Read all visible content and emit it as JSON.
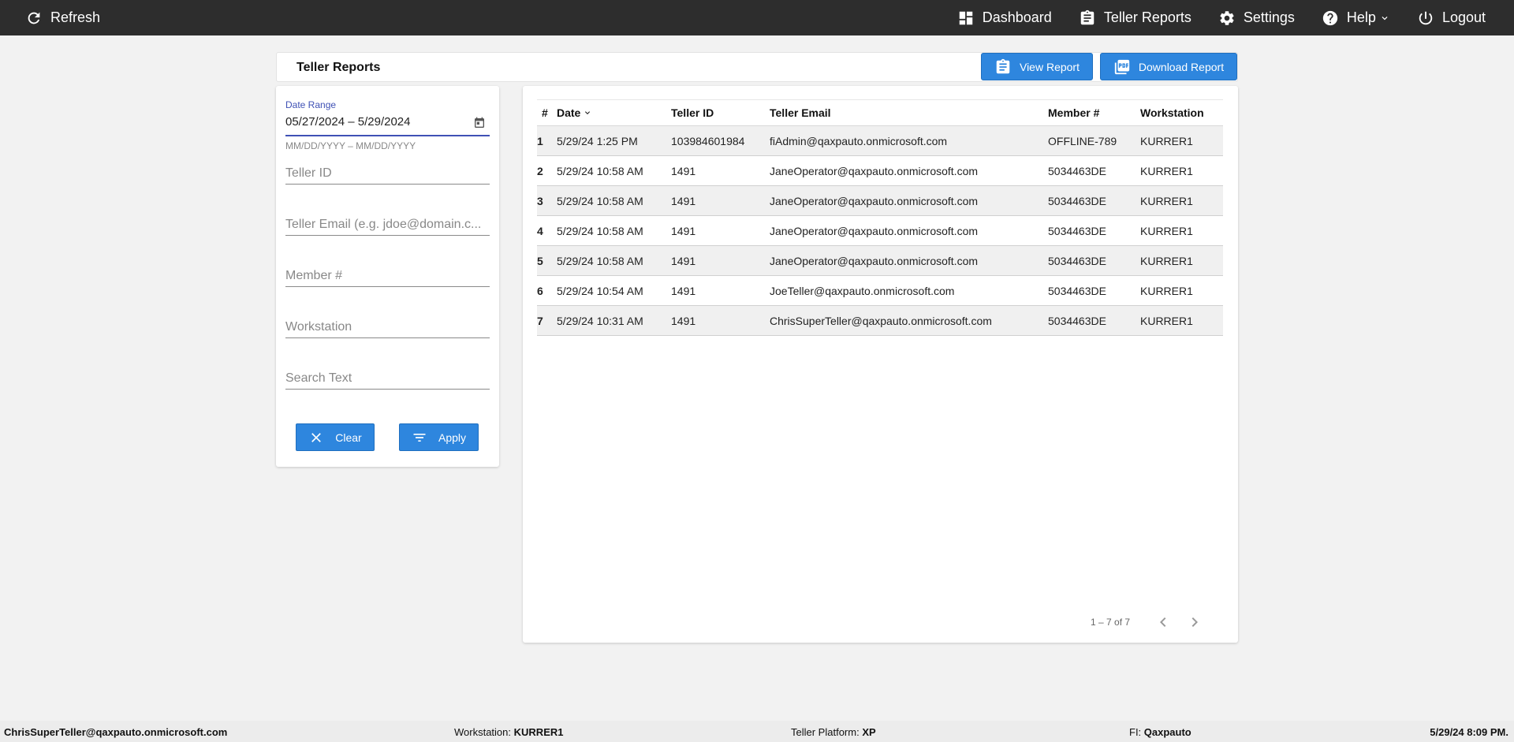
{
  "topbar": {
    "refresh_label": "Refresh",
    "nav": {
      "dashboard": "Dashboard",
      "teller_reports": "Teller Reports",
      "settings": "Settings",
      "help": "Help",
      "logout": "Logout"
    }
  },
  "header": {
    "title": "Teller Reports",
    "view_report_label": "View Report",
    "download_report_label": "Download Report"
  },
  "filters": {
    "date_range_label": "Date Range",
    "date_range_value": "05/27/2024 – 5/29/2024",
    "date_range_hint": "MM/DD/YYYY – MM/DD/YYYY",
    "teller_id_placeholder": "Teller ID",
    "teller_email_placeholder": "Teller Email (e.g. jdoe@domain.c...",
    "member_placeholder": "Member #",
    "workstation_placeholder": "Workstation",
    "search_placeholder": "Search Text",
    "clear_label": "Clear",
    "apply_label": "Apply"
  },
  "table": {
    "columns": [
      "#",
      "Date",
      "Teller ID",
      "Teller Email",
      "Member #",
      "Workstation"
    ],
    "rows": [
      [
        "1",
        "5/29/24 1:25 PM",
        "103984601984",
        "fiAdmin@qaxpauto.onmicrosoft.com",
        "OFFLINE-789",
        "KURRER1"
      ],
      [
        "2",
        "5/29/24 10:58 AM",
        "1491",
        "JaneOperator@qaxpauto.onmicrosoft.com",
        "5034463DE",
        "KURRER1"
      ],
      [
        "3",
        "5/29/24 10:58 AM",
        "1491",
        "JaneOperator@qaxpauto.onmicrosoft.com",
        "5034463DE",
        "KURRER1"
      ],
      [
        "4",
        "5/29/24 10:58 AM",
        "1491",
        "JaneOperator@qaxpauto.onmicrosoft.com",
        "5034463DE",
        "KURRER1"
      ],
      [
        "5",
        "5/29/24 10:58 AM",
        "1491",
        "JaneOperator@qaxpauto.onmicrosoft.com",
        "5034463DE",
        "KURRER1"
      ],
      [
        "6",
        "5/29/24 10:54 AM",
        "1491",
        "JoeTeller@qaxpauto.onmicrosoft.com",
        "5034463DE",
        "KURRER1"
      ],
      [
        "7",
        "5/29/24 10:31 AM",
        "1491",
        "ChrisSuperTeller@qaxpauto.onmicrosoft.com",
        "5034463DE",
        "KURRER1"
      ]
    ],
    "pagination": "1 – 7 of 7"
  },
  "footer": {
    "user": "ChrisSuperTeller@qaxpauto.onmicrosoft.com",
    "workstation_label": "Workstation:",
    "workstation_value": "KURRER1",
    "platform_label": "Teller Platform:",
    "platform_value": "XP",
    "fi_label": "FI:",
    "fi_value": "Qaxpauto",
    "datetime": "5/29/24 8:09 PM."
  },
  "colors": {
    "topbar_bg": "#2d2d2d",
    "accent_blue": "#2e86de",
    "focus_indigo": "#3f51b5",
    "page_bg": "#f2f2f2"
  },
  "icons": [
    "refresh-icon",
    "dashboard-icon",
    "clipboard-icon",
    "gear-icon",
    "help-icon",
    "chevron-down-icon",
    "power-icon",
    "pdf-icon",
    "calendar-icon",
    "close-icon",
    "filter-icon",
    "chevron-left-icon",
    "chevron-right-icon"
  ]
}
